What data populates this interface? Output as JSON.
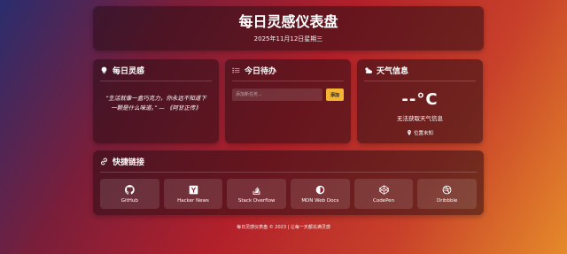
{
  "header": {
    "title": "每日灵感仪表盘",
    "date": "2025年11月12日星期三"
  },
  "inspiration": {
    "title": "每日灵感",
    "icon": "lightbulb-icon",
    "quote": "“生活就像一盒巧克力，你永远不知道下一颗是什么味道。” — 《阿甘正传》"
  },
  "todo": {
    "title": "今日待办",
    "icon": "list-icon",
    "placeholder": "添加新任务...",
    "add_label": "添加"
  },
  "weather": {
    "title": "天气信息",
    "icon": "cloud-sun-icon",
    "temp": "--°C",
    "message": "无法获取天气信息",
    "location": "位置未知"
  },
  "links": {
    "title": "快捷链接",
    "icon": "link-icon",
    "items": [
      {
        "label": "GitHub",
        "icon": "github-icon"
      },
      {
        "label": "Hacker News",
        "icon": "hacker-news-icon"
      },
      {
        "label": "Stack Overflow",
        "icon": "stack-overflow-icon"
      },
      {
        "label": "MDN Web Docs",
        "icon": "mdn-icon"
      },
      {
        "label": "CodePen",
        "icon": "codepen-icon"
      },
      {
        "label": "Dribbble",
        "icon": "dribbble-icon"
      }
    ]
  },
  "footer": {
    "text": "每日灵感仪表盘 © 2023 | 让每一天都充满灵感"
  },
  "colors": {
    "accent": "#f4b533"
  }
}
